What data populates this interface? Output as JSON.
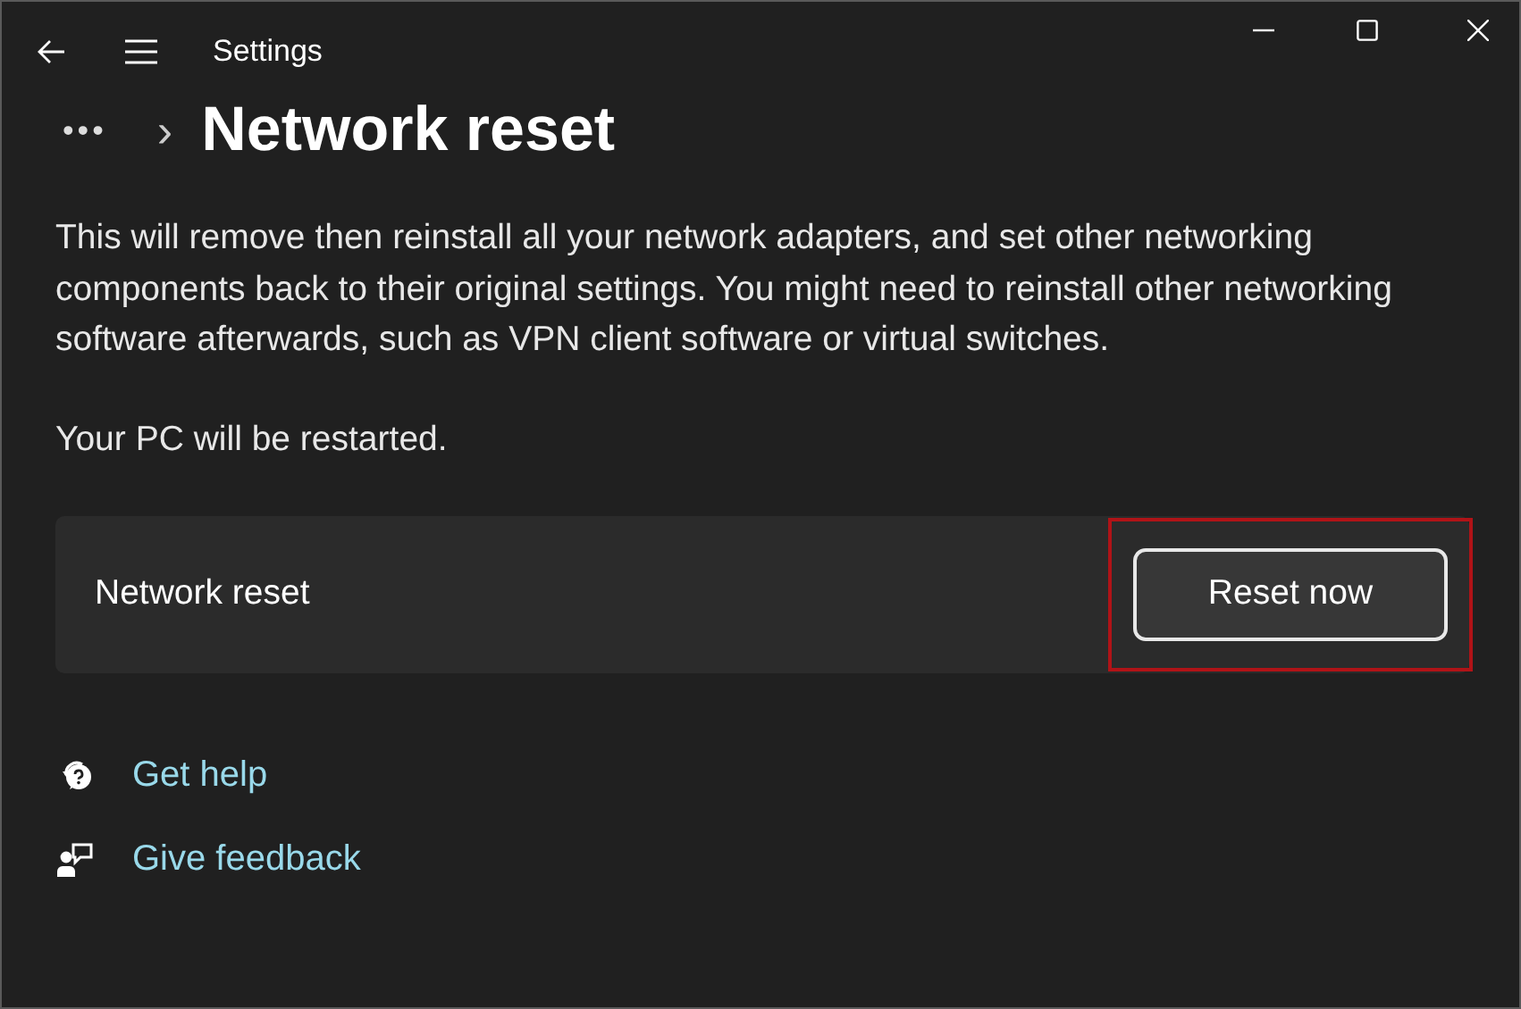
{
  "window": {
    "title": "Settings"
  },
  "breadcrumb": {
    "overflow": "•••",
    "separator": "›",
    "current": "Network reset"
  },
  "description": "This will remove then reinstall all your network adapters, and set other networking components back to their original settings. You might need to reinstall other networking software afterwards, such as VPN client software or virtual switches.",
  "note": "Your PC will be restarted.",
  "card": {
    "label": "Network reset",
    "button": {
      "label": "Reset now",
      "highlighted": true
    }
  },
  "links": [
    {
      "kind": "help",
      "label": "Get help"
    },
    {
      "kind": "feedback",
      "label": "Give feedback"
    }
  ]
}
